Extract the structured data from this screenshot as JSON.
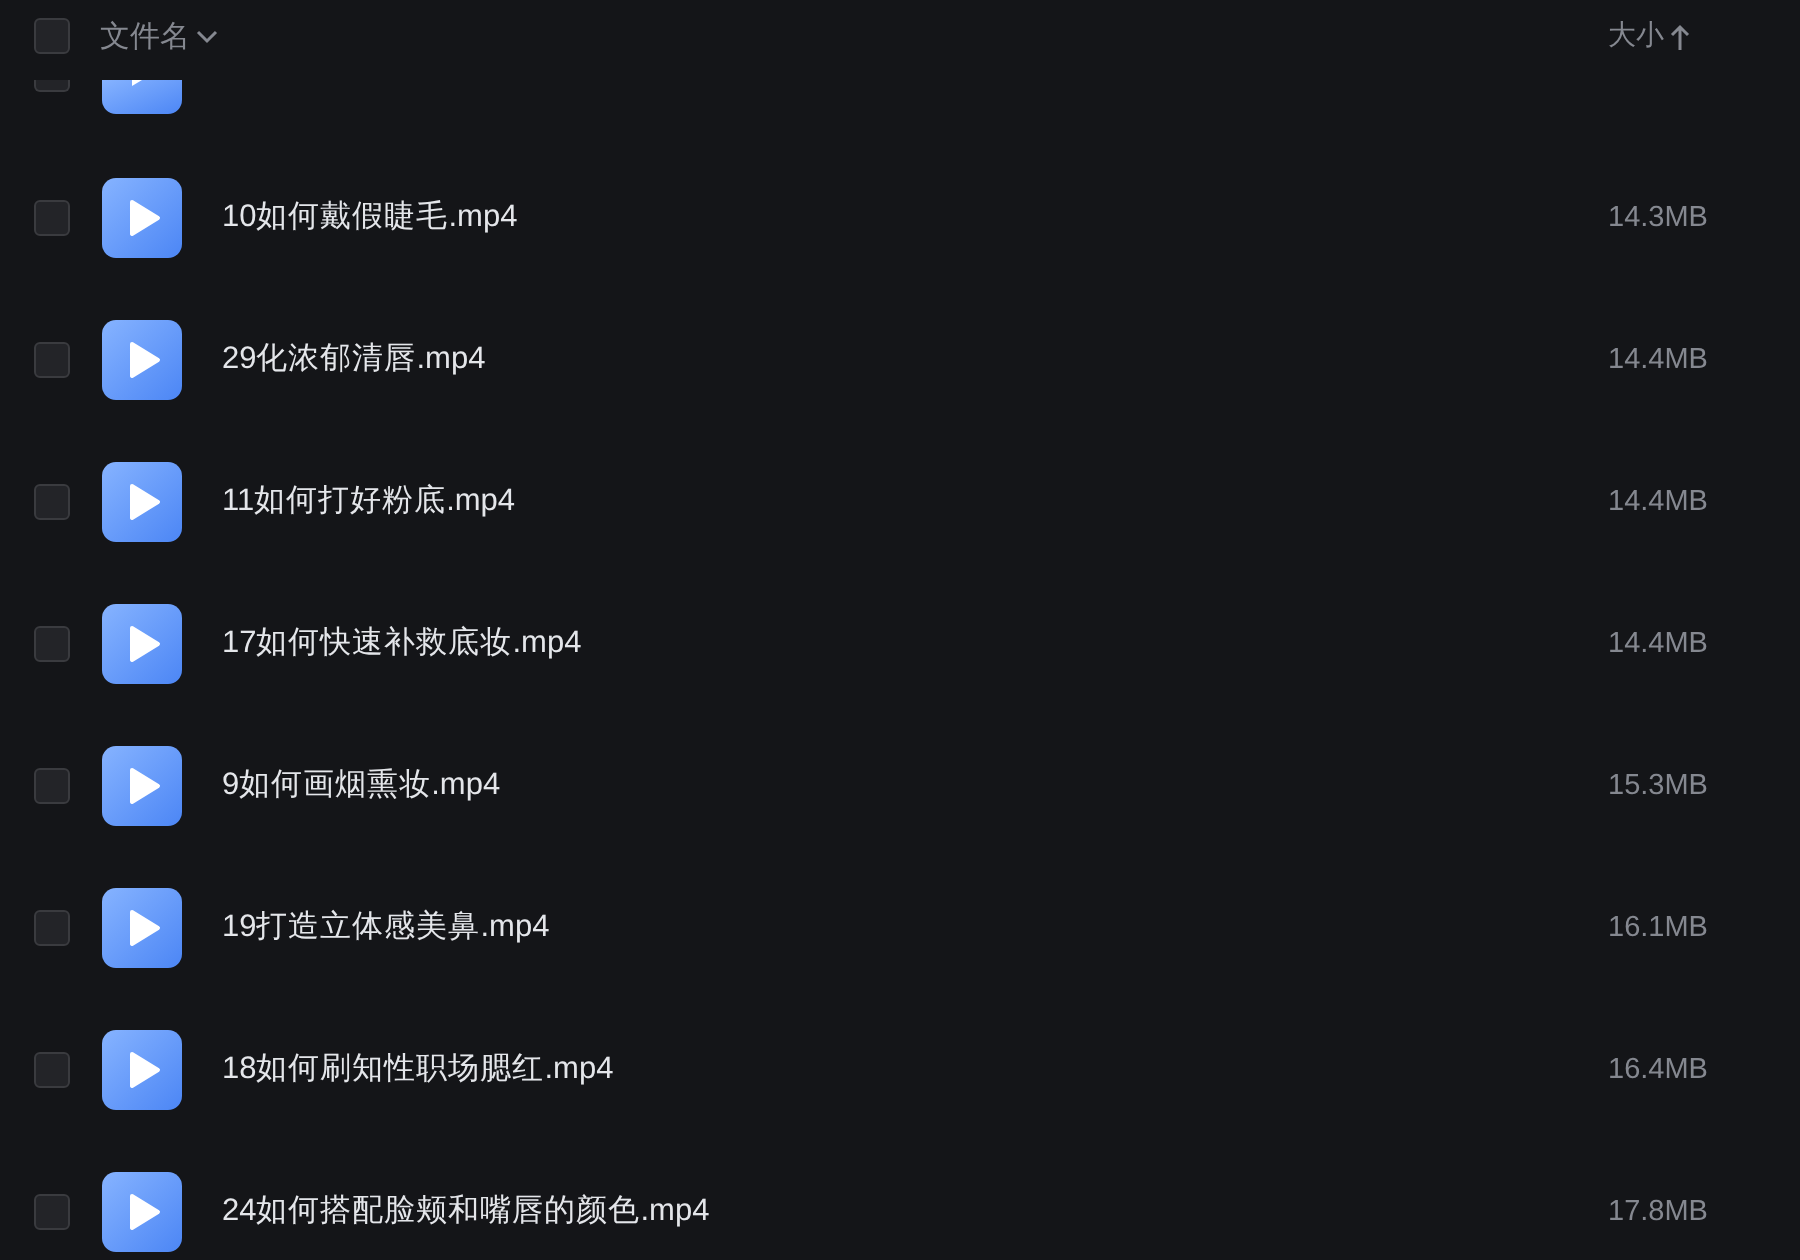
{
  "header": {
    "checked": false,
    "name_label": "文件名",
    "size_label": "大小"
  },
  "rows": [
    {
      "kind": "hidden",
      "checked": false
    },
    {
      "kind": "file",
      "checked": false,
      "name": "10如何戴假睫毛.mp4",
      "size": "14.3MB"
    },
    {
      "kind": "file",
      "checked": false,
      "name": "29化浓郁清唇.mp4",
      "size": "14.4MB"
    },
    {
      "kind": "file",
      "checked": false,
      "name": "11如何打好粉底.mp4",
      "size": "14.4MB"
    },
    {
      "kind": "file",
      "checked": false,
      "name": "17如何快速补救底妆.mp4",
      "size": "14.4MB"
    },
    {
      "kind": "file",
      "checked": false,
      "name": "9如何画烟熏妆.mp4",
      "size": "15.3MB"
    },
    {
      "kind": "file",
      "checked": false,
      "name": "19打造立体感美鼻.mp4",
      "size": "16.1MB"
    },
    {
      "kind": "file",
      "checked": false,
      "name": "18如何刷知性职场腮红.mp4",
      "size": "16.4MB"
    },
    {
      "kind": "file",
      "checked": false,
      "name": "24如何搭配脸颊和嘴唇的颜色.mp4",
      "size": "17.8MB"
    }
  ]
}
